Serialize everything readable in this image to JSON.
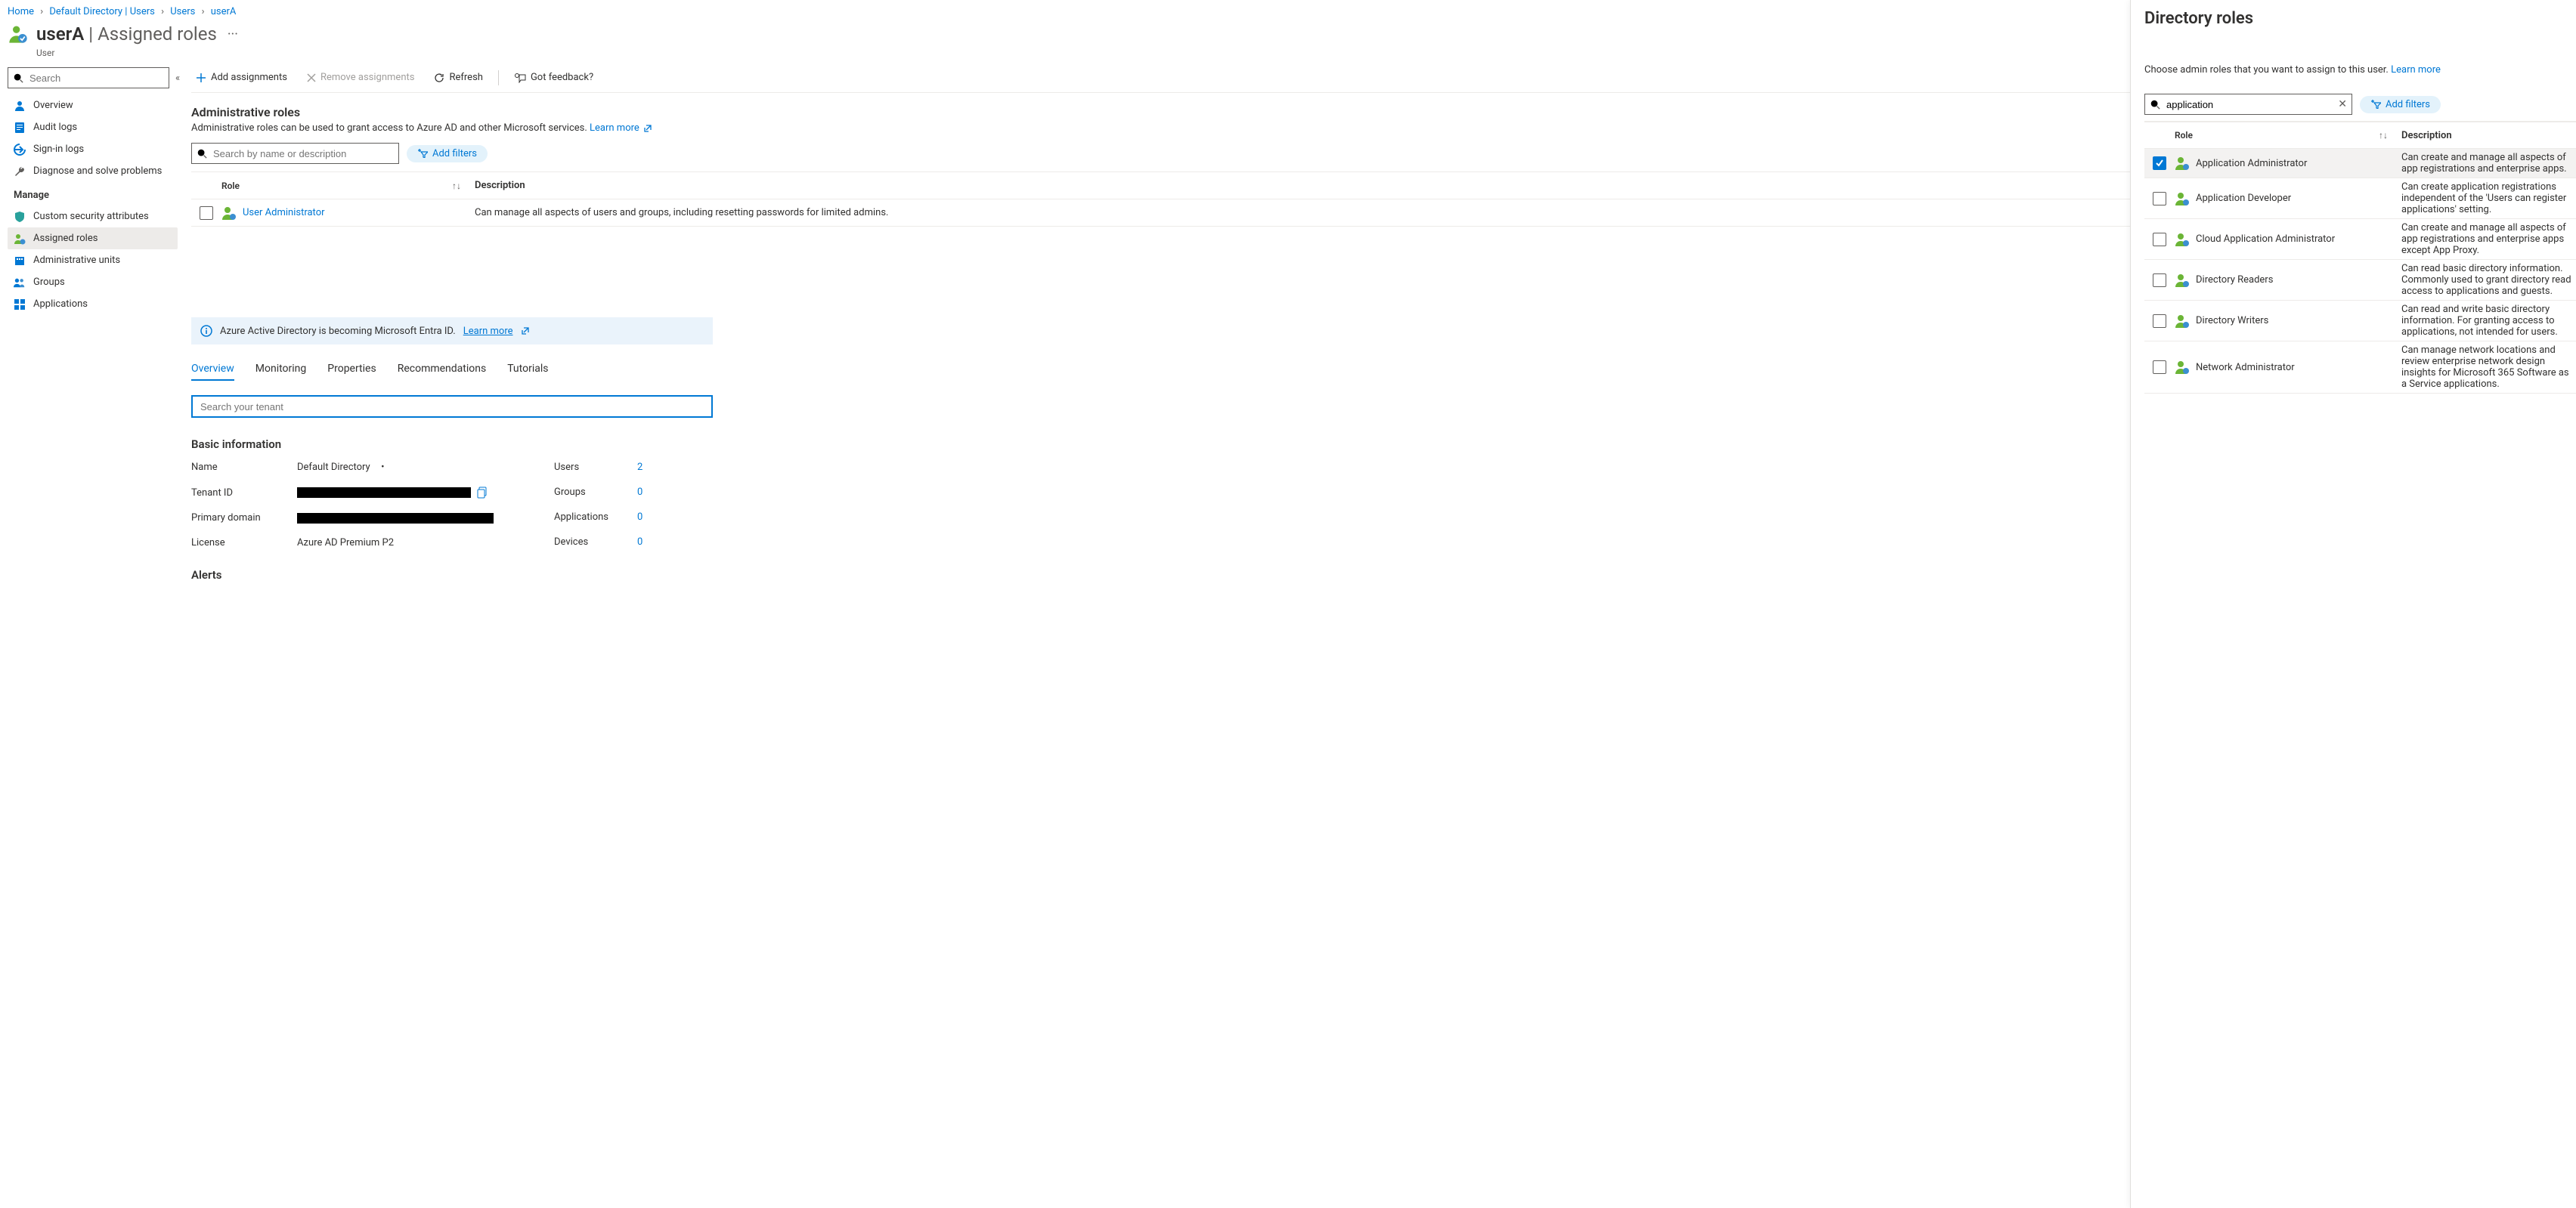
{
  "breadcrumbs": {
    "items": [
      "Home",
      "Default Directory | Users",
      "Users",
      "userA"
    ]
  },
  "header": {
    "name": "userA",
    "suffix": "Assigned roles",
    "type": "User"
  },
  "nav": {
    "search_placeholder": "Search",
    "top": [
      {
        "label": "Overview"
      },
      {
        "label": "Audit logs"
      },
      {
        "label": "Sign-in logs"
      },
      {
        "label": "Diagnose and solve problems"
      }
    ],
    "manage_header": "Manage",
    "manage": [
      {
        "label": "Custom security attributes"
      },
      {
        "label": "Assigned roles",
        "active": true
      },
      {
        "label": "Administrative units"
      },
      {
        "label": "Groups"
      },
      {
        "label": "Applications"
      }
    ]
  },
  "toolbar": {
    "add": "Add assignments",
    "remove": "Remove assignments",
    "refresh": "Refresh",
    "feedback": "Got feedback?"
  },
  "admin_section": {
    "title": "Administrative roles",
    "desc": "Administrative roles can be used to grant access to Azure AD and other Microsoft services.",
    "learn": "Learn more",
    "search_placeholder": "Search by name or description",
    "add_filters": "Add filters",
    "col_role": "Role",
    "col_desc": "Description",
    "rows": [
      {
        "name": "User Administrator",
        "desc": "Can manage all aspects of users and groups, including resetting passwords for limited admins."
      }
    ]
  },
  "banner": {
    "text": "Azure Active Directory is becoming Microsoft Entra ID.",
    "link": "Learn more"
  },
  "lower_tabs": [
    "Overview",
    "Monitoring",
    "Properties",
    "Recommendations",
    "Tutorials"
  ],
  "tenant_search_placeholder": "Search your tenant",
  "basic_info_title": "Basic information",
  "basic_info": {
    "name_label": "Name",
    "name_value": "Default Directory",
    "tenant_label": "Tenant ID",
    "domain_label": "Primary domain",
    "license_label": "License",
    "license_value": "Azure AD Premium P2",
    "users_label": "Users",
    "users_value": "2",
    "groups_label": "Groups",
    "groups_value": "0",
    "apps_label": "Applications",
    "apps_value": "0",
    "devices_label": "Devices",
    "devices_value": "0"
  },
  "alerts_title": "Alerts",
  "flyout": {
    "title": "Directory roles",
    "desc": "Choose admin roles that you want to assign to this user.",
    "learn": "Learn more",
    "search_value": "application",
    "add_filters": "Add filters",
    "col_role": "Role",
    "col_desc": "Description",
    "rows": [
      {
        "name": "Application Administrator",
        "desc": "Can create and manage all aspects of app registrations and enterprise apps.",
        "checked": true
      },
      {
        "name": "Application Developer",
        "desc": "Can create application registrations independent of the 'Users can register applications' setting."
      },
      {
        "name": "Cloud Application Administrator",
        "desc": "Can create and manage all aspects of app registrations and enterprise apps except App Proxy."
      },
      {
        "name": "Directory Readers",
        "desc": "Can read basic directory information. Commonly used to grant directory read access to applications and guests."
      },
      {
        "name": "Directory Writers",
        "desc": "Can read and write basic directory information. For granting access to applications, not intended for users."
      },
      {
        "name": "Network Administrator",
        "desc": "Can manage network locations and review enterprise network design insights for Microsoft 365 Software as a Service applications."
      }
    ]
  }
}
